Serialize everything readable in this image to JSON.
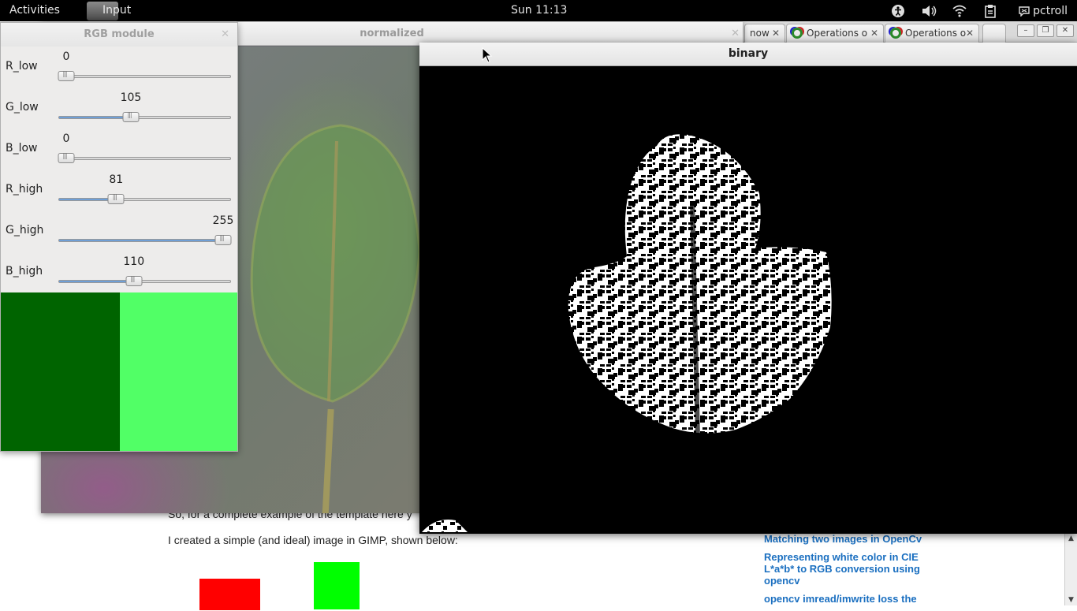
{
  "top_panel": {
    "activities": "Activities",
    "app_name": "Input",
    "clock": "Sun 11:13",
    "user": "pctroll"
  },
  "browser": {
    "tabs": [
      {
        "label": "now"
      },
      {
        "label": "Operations o"
      },
      {
        "label": "Operations o"
      }
    ]
  },
  "webpage": {
    "text_line1": "So, for a complete example of the template here y",
    "text_line2": "I created a simple (and ideal) image in GIMP, shown below:",
    "related": [
      "Matching two images in OpenCv",
      "Representing white color in CIE L*a*b* to RGB conversion using opencv",
      "opencv imread/imwrite loss the"
    ]
  },
  "normalized_window": {
    "title": "normalized"
  },
  "rgb_module": {
    "title": "RGB module",
    "sliders": [
      {
        "name": "R_low",
        "value": "0",
        "fraction": 0.0
      },
      {
        "name": "G_low",
        "value": "105",
        "fraction": 0.412
      },
      {
        "name": "B_low",
        "value": "0",
        "fraction": 0.0
      },
      {
        "name": "R_high",
        "value": "81",
        "fraction": 0.318
      },
      {
        "name": "G_high",
        "value": "255",
        "fraction": 1.0
      },
      {
        "name": "B_high",
        "value": "110",
        "fraction": 0.431
      }
    ],
    "swatch_low_color": "#006400",
    "swatch_high_color": "#51ff66",
    "slider_fill_color": "#6f9fd6"
  },
  "binary_window": {
    "title": "binary"
  },
  "colors": {
    "panel_bg": "#000000",
    "link_blue": "#1a6fc0"
  }
}
